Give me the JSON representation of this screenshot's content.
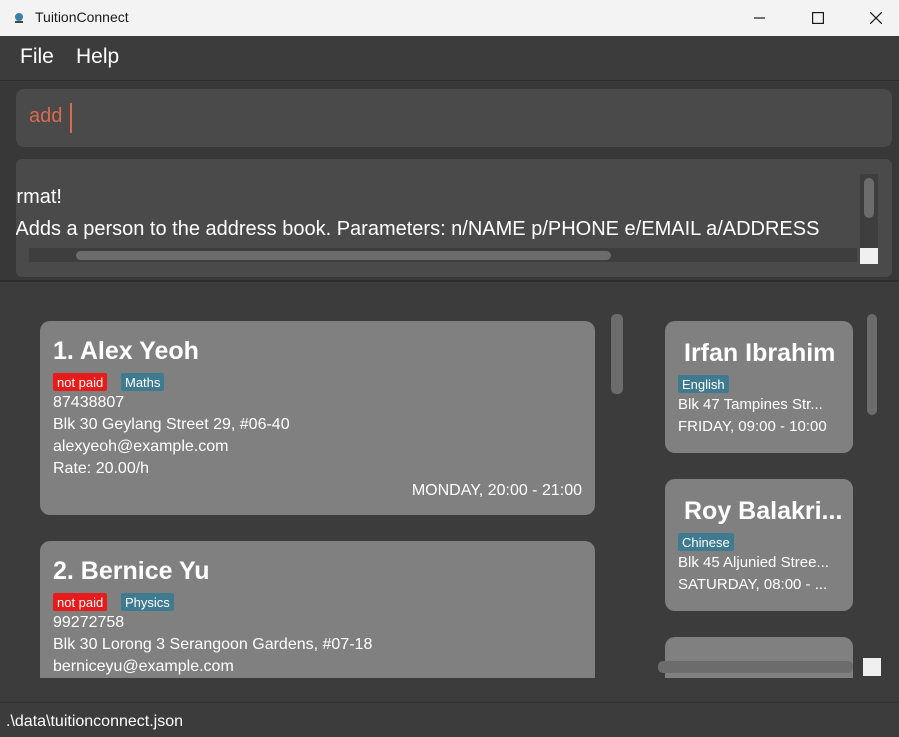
{
  "window": {
    "title": "TuitionConnect"
  },
  "menu": {
    "file": "File",
    "help": "Help"
  },
  "command": {
    "value": "add "
  },
  "result": {
    "line1": "Invalid command format!",
    "line2": "add: Adds a person to the address book. Parameters: n/NAME p/PHONE e/EMAIL a/ADDRESS"
  },
  "persons": [
    {
      "index_name": "1.  Alex Yeoh",
      "status_tag": "not paid",
      "subject_tag": "Maths",
      "phone": "87438807",
      "address": "Blk 30 Geylang Street 29, #06-40",
      "email": "alexyeoh@example.com",
      "rate": "Rate: 20.00/h",
      "schedule": "MONDAY, 20:00 - 21:00"
    },
    {
      "index_name": "2.  Bernice Yu",
      "status_tag": "not paid",
      "subject_tag": "Physics",
      "phone": "99272758",
      "address": "Blk 30 Lorong 3 Serangoon Gardens, #07-18",
      "email": "berniceyu@example.com"
    }
  ],
  "schedule_list": [
    {
      "name": "Irfan Ibrahim",
      "subject_tag": "English",
      "address": "Blk 47 Tampines Str...",
      "schedule": "FRIDAY, 09:00 - 10:00"
    },
    {
      "name": "Roy Balakri...",
      "subject_tag": "Chinese",
      "address": "Blk 45 Aljunied Stree...",
      "schedule": "SATURDAY, 08:00 - ..."
    }
  ],
  "status": {
    "file_path": ".\\data\\tuitionconnect.json"
  },
  "colors": {
    "background": "#3c3c3c",
    "card": "#808080",
    "command_text": "#d96a4e",
    "tag_unpaid": "#e81b1b",
    "tag_subject": "#3e7b91"
  }
}
